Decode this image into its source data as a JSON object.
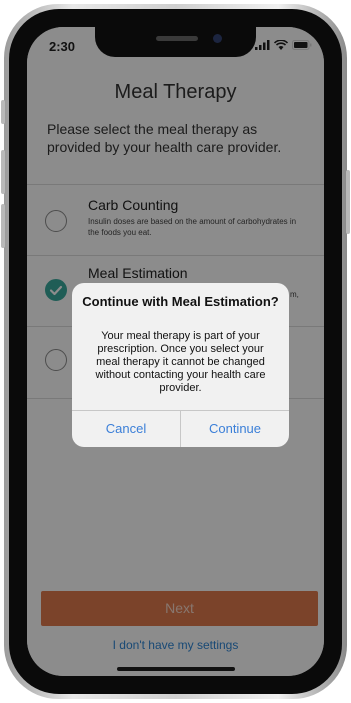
{
  "status": {
    "time": "2:30",
    "icons": [
      "signal-icon",
      "wifi-icon",
      "battery-icon"
    ]
  },
  "screen": {
    "title": "Meal Therapy",
    "subtitle": "Please select the meal therapy as provided by your health care provider."
  },
  "options": [
    {
      "title": "Carb Counting",
      "description": "Insulin doses are based on the amount of carbohydrates in the foods you eat.",
      "selected": false
    },
    {
      "title": "Meal Estimation",
      "description": "m,",
      "selected": true
    },
    {
      "title": "",
      "description": "",
      "selected": false
    }
  ],
  "alert": {
    "title": "Continue with Meal Estimation?",
    "message": "Your meal therapy is part of your prescription. Once you select your meal therapy it cannot be changed without contacting your health care provider.",
    "cancel_label": "Cancel",
    "continue_label": "Continue"
  },
  "footer": {
    "next_label": "Next",
    "settings_link": "I don't have my settings"
  },
  "colors": {
    "accent_teal": "#3aa99d",
    "next_button": "#e07a4e",
    "link_blue": "#2e86d6",
    "alert_button_blue": "#3b7fd8"
  }
}
